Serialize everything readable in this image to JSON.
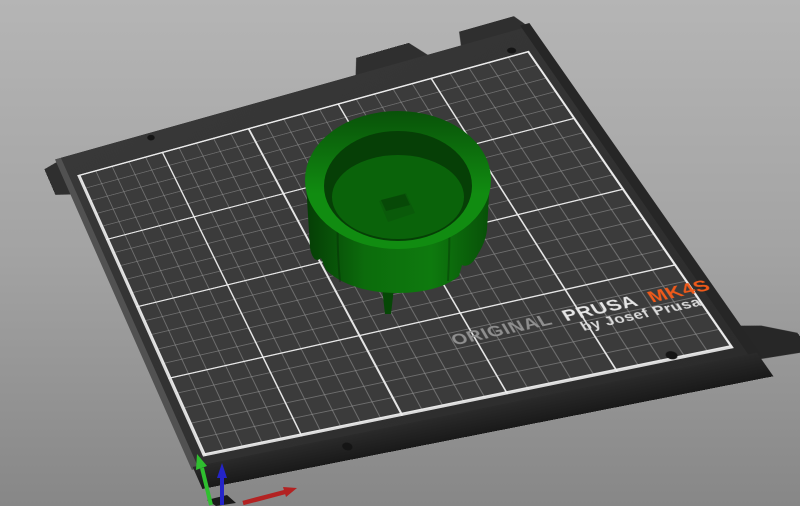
{
  "scene": {
    "background_top": "#b5b5b5",
    "background_bottom": "#878787"
  },
  "plate": {
    "brand": {
      "original": "ORIGINAL",
      "prusa": "PRUSA",
      "model": "MK4S",
      "byline": "by Josef Prusa"
    },
    "colors": {
      "sheet": "#323232",
      "grid_area": "#3b3b3b",
      "grid_minor_line": "#969696",
      "grid_major_line": "#ececec",
      "brand_original": "#8f8f8f",
      "brand_prusa": "#e6e6e6",
      "brand_model_orange": "#f05a1a",
      "brand_byline": "#dcdcdc"
    }
  },
  "model": {
    "description": "green cylindrical cap with square socket and spout",
    "colors": {
      "wall_dark": "#053d05",
      "wall_mid": "#0c6c0c",
      "wall_light": "#0e7a0e",
      "wall_edge": "#085008",
      "rim_back": "#095209",
      "rim_front": "#118c11",
      "cavity": "#063f06",
      "floor": "#0a630a",
      "boss_top": "#074907",
      "boss_front": "#0a5a0a",
      "stem": "#064806",
      "facet_shadow": "rgba(0,0,0,0.22)"
    }
  },
  "axes": {
    "x": {
      "color": "#b32222"
    },
    "y": {
      "color": "#2fbf2f"
    },
    "z": {
      "color": "#2424c8"
    },
    "origin_cube": "#1a1a1a"
  }
}
